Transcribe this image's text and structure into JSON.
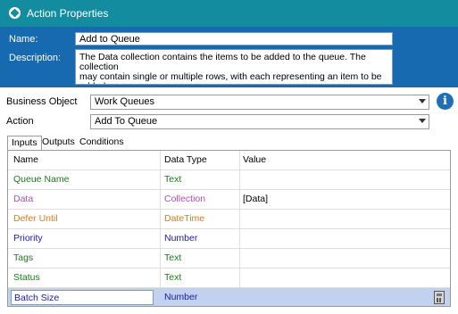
{
  "window": {
    "title": "Action Properties",
    "icon": "blueprism-diamond-icon"
  },
  "header": {
    "name_label": "Name:",
    "name_value": "Add to Queue",
    "description_label": "Description:",
    "description_line1": "The Data collection contains the items to be added to the queue. The collection",
    "description_line2": "may contain single or multiple rows, with each representing an item to be added."
  },
  "business_object": {
    "label": "Business Object",
    "value": "Work Queues"
  },
  "action": {
    "label": "Action",
    "value": "Add To Queue"
  },
  "tabs": [
    {
      "label": "Inputs",
      "active": true
    },
    {
      "label": "Outputs",
      "active": false
    },
    {
      "label": "Conditions",
      "active": false
    }
  ],
  "grid": {
    "columns": [
      "Name",
      "Data Type",
      "Value"
    ],
    "rows": [
      {
        "name": "Queue Name",
        "type": "Text",
        "value": "",
        "color": "#1a7a1a"
      },
      {
        "name": "Data",
        "type": "Collection",
        "value": "[Data]",
        "color": "#b54cb5"
      },
      {
        "name": "Defer Until",
        "type": "DateTime",
        "value": "",
        "color": "#e07b1a"
      },
      {
        "name": "Priority",
        "type": "Number",
        "value": "",
        "color": "#1a1aa8"
      },
      {
        "name": "Tags",
        "type": "Text",
        "value": "",
        "color": "#1a7a1a"
      },
      {
        "name": "Status",
        "type": "Text",
        "value": "",
        "color": "#1a7a1a"
      },
      {
        "name": "Batch Size",
        "type": "Number",
        "value": "",
        "color": "#1a1aa8",
        "selected": true
      }
    ]
  }
}
